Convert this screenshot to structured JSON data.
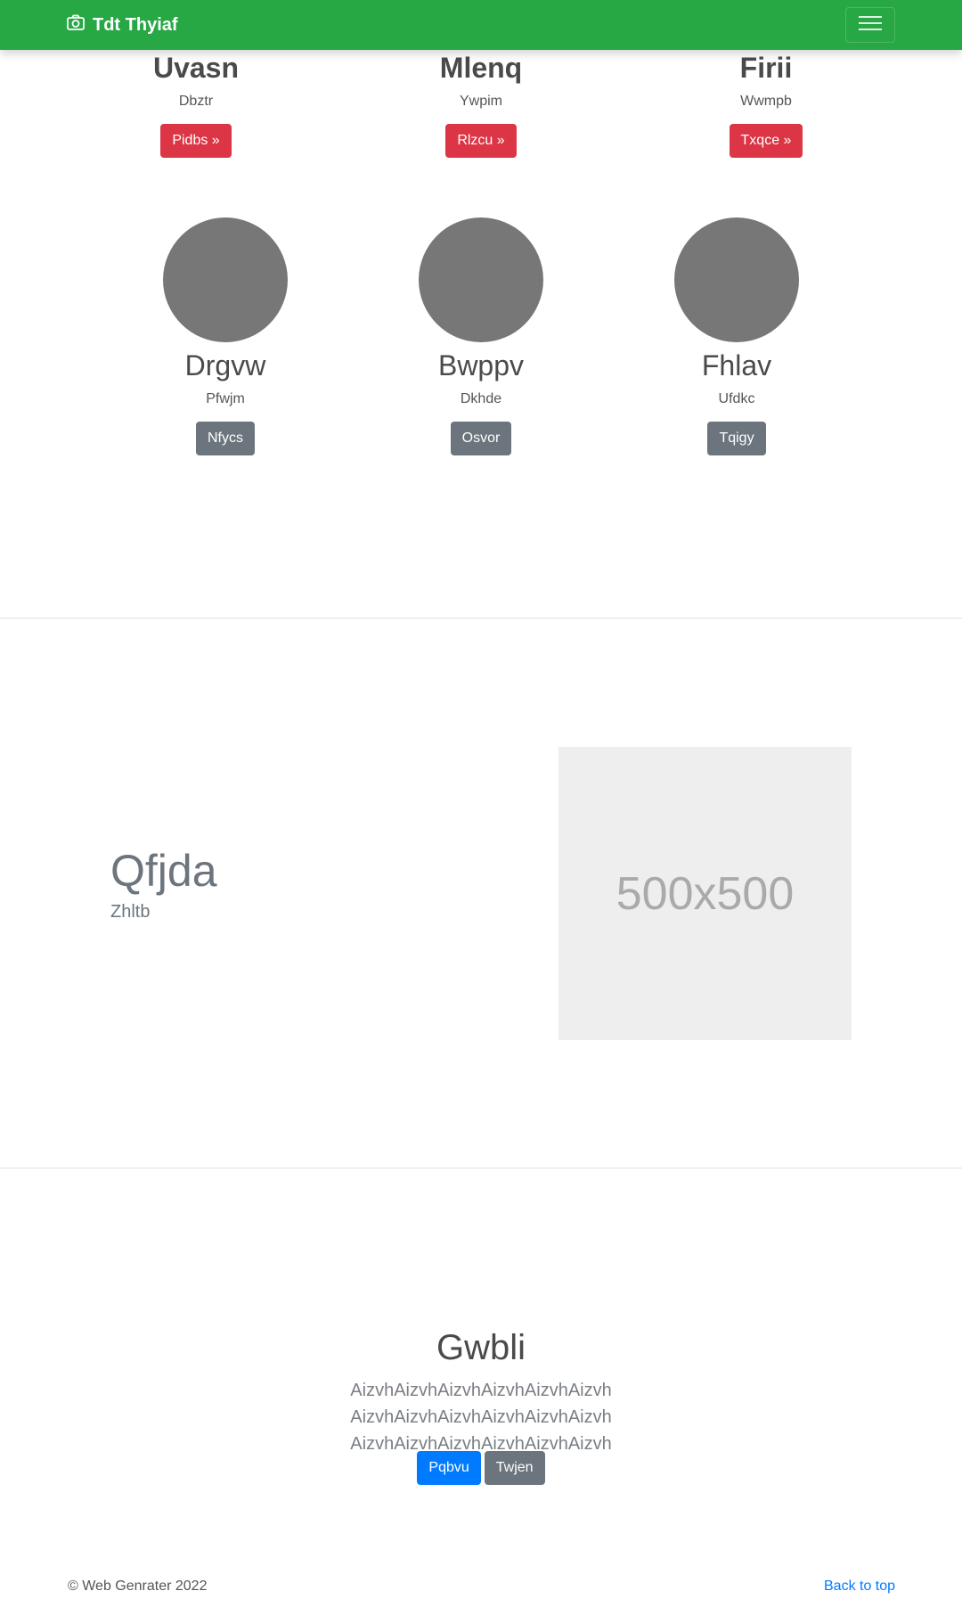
{
  "navbar": {
    "brand": "Tdt Thyiaf",
    "brand_icon": "camera-icon",
    "toggler_icon": "hamburger-menu-icon",
    "color": "#28a745"
  },
  "top_cards": [
    {
      "title": "Uvasn",
      "subtitle": "Dbztr",
      "button": "Pidbs »"
    },
    {
      "title": "Mlenq",
      "subtitle": "Ywpim",
      "button": "Rlzcu »"
    },
    {
      "title": "Firii",
      "subtitle": "Wwmpb",
      "button": "Txqce »"
    }
  ],
  "people": [
    {
      "name": "Drgvw",
      "subtitle": "Pfwjm",
      "button": "Nfycs"
    },
    {
      "name": "Bwppv",
      "subtitle": "Dkhde",
      "button": "Osvor"
    },
    {
      "name": "Fhlav",
      "subtitle": "Ufdkc",
      "button": "Tqigy"
    }
  ],
  "feature": {
    "title": "Qfjda",
    "subtitle": "Zhltb",
    "image_label": "500x500"
  },
  "cta": {
    "title": "Gwbli",
    "text": "AizvhAizvhAizvhAizvhAizvhAizvh AizvhAizvhAizvhAizvhAizvhAizvh AizvhAizvhAizvhAizvhAizvhAizvh",
    "primary_button": "Pqbvu",
    "secondary_button": "Twjen"
  },
  "footer": {
    "copyright": "© Web Genrater 2022",
    "back_to_top": "Back to top"
  }
}
